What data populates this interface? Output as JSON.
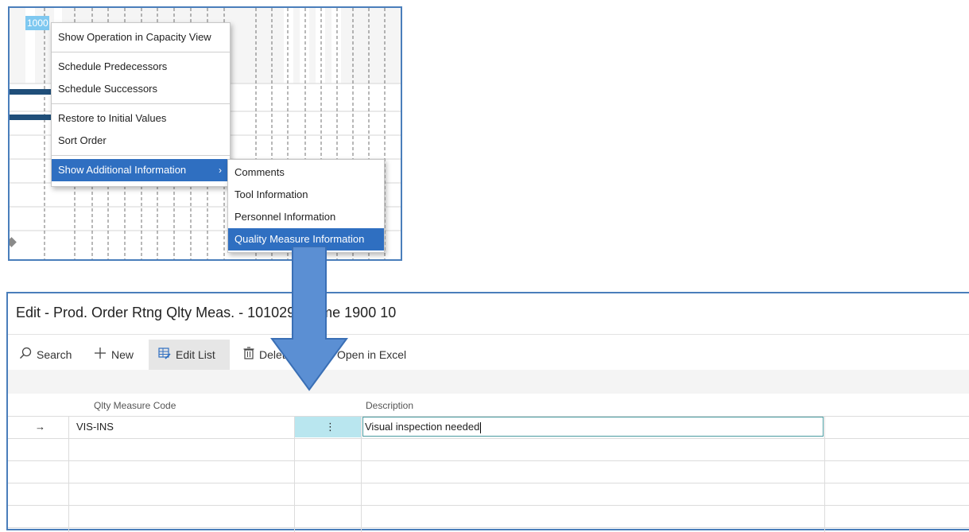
{
  "gantt": {
    "badge": "1000",
    "context_menu": {
      "items": [
        "Show Operation in Capacity View",
        "Schedule Predecessors",
        "Schedule Successors",
        "Restore to Initial Values",
        "Sort Order",
        "Show Additional Information"
      ],
      "submenu_arrow": "›"
    },
    "submenu": {
      "items": [
        "Comments",
        "Tool Information",
        "Personnel Information",
        "Quality Measure Information"
      ]
    }
  },
  "page": {
    "title": "Edit - Prod. Order Rtng Qlty Meas. - 101029 Frame 1900 10",
    "toolbar": {
      "search": "Search",
      "new": "New",
      "edit_list": "Edit List",
      "delete": "Delete",
      "open_in_excel": "Open in Excel"
    },
    "columns": {
      "code": "Qlty Measure Code",
      "description": "Description"
    },
    "rows": [
      {
        "indicator": "→",
        "code": "VIS-INS",
        "menu": "⋮",
        "description": "Visual inspection needed"
      }
    ]
  },
  "colors": {
    "accent": "#2f6fc1",
    "arrow": "#5b8fd3",
    "frame": "#4a7ebb",
    "selected_cell": "#b9e6ef"
  }
}
